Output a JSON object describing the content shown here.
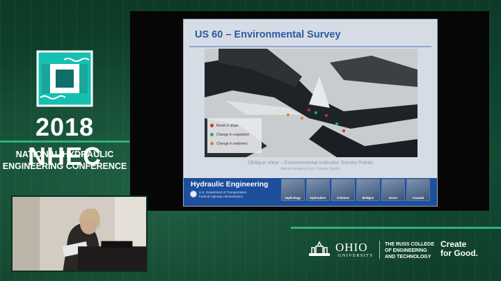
{
  "conference": {
    "year": "2018",
    "acronym": "NHEC",
    "name_line1": "NATIONAL HYDRAULIC",
    "name_line2": "ENGINEERING CONFERENCE",
    "accent_color": "#2fb37a"
  },
  "slide": {
    "title": "US 60 – Environmental Survey",
    "legend": [
      {
        "label": "Break in slope",
        "color": "#c0392b"
      },
      {
        "label": "Change in vegetation",
        "color": "#27ae60"
      },
      {
        "label": "Change in sediment",
        "color": "#e67e22"
      }
    ],
    "caption": "Oblique View – Environmental Indicator Survey Points",
    "subcaption": "(Aerial imagery from Google Earth)",
    "footer_title": "Hydraulic Engineering",
    "footer_org_line1": "U.S. Department of Transportation",
    "footer_org_line2": "Federal Highway Administration",
    "thumbnails": [
      "Hydrology",
      "Hydraulics",
      "Culverts",
      "Bridges",
      "Scour",
      "Coastal"
    ]
  },
  "sponsors": {
    "ohio_name": "OHIO",
    "ohio_sub": "UNIVERSITY",
    "russ_line1": "THE RUSS COLLEGE",
    "russ_line2": "OF ENGINEERING",
    "russ_line3": "AND TECHNOLOGY",
    "tagline_line1": "Create",
    "tagline_line2": "for Good."
  }
}
